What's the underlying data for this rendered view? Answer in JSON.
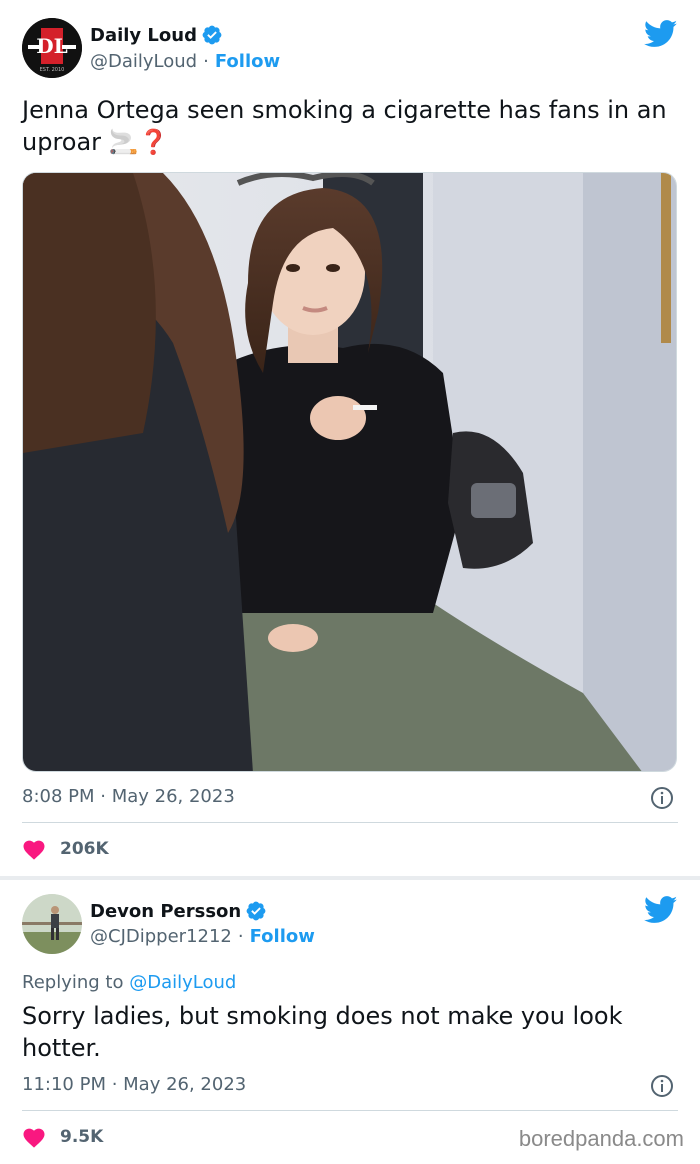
{
  "tweet1": {
    "display_name": "Daily Loud",
    "handle": "@DailyLoud",
    "follow_label": "Follow",
    "text": "Jenna Ortega seen smoking a cigarette has fans in an uproar 🚬❓",
    "timestamp": "8:08 PM · May 26, 2023",
    "likes": "206K",
    "avatar_logo_text": "DL"
  },
  "tweet2": {
    "display_name": "Devon Persson",
    "handle": "@CJDipper1212",
    "follow_label": "Follow",
    "replying_prefix": "Replying to",
    "replying_handle": "@DailyLoud",
    "text": "Sorry ladies, but smoking does not make you look hotter.",
    "timestamp": "11:10 PM · May 26, 2023",
    "likes": "9.5K"
  },
  "watermark": "boredpanda.com",
  "colors": {
    "accent": "#1d9bf0",
    "heart": "#f91880",
    "secondary_text": "#536471"
  },
  "icons": [
    "verified-badge-icon",
    "twitter-bird-icon",
    "info-icon",
    "heart-icon"
  ]
}
